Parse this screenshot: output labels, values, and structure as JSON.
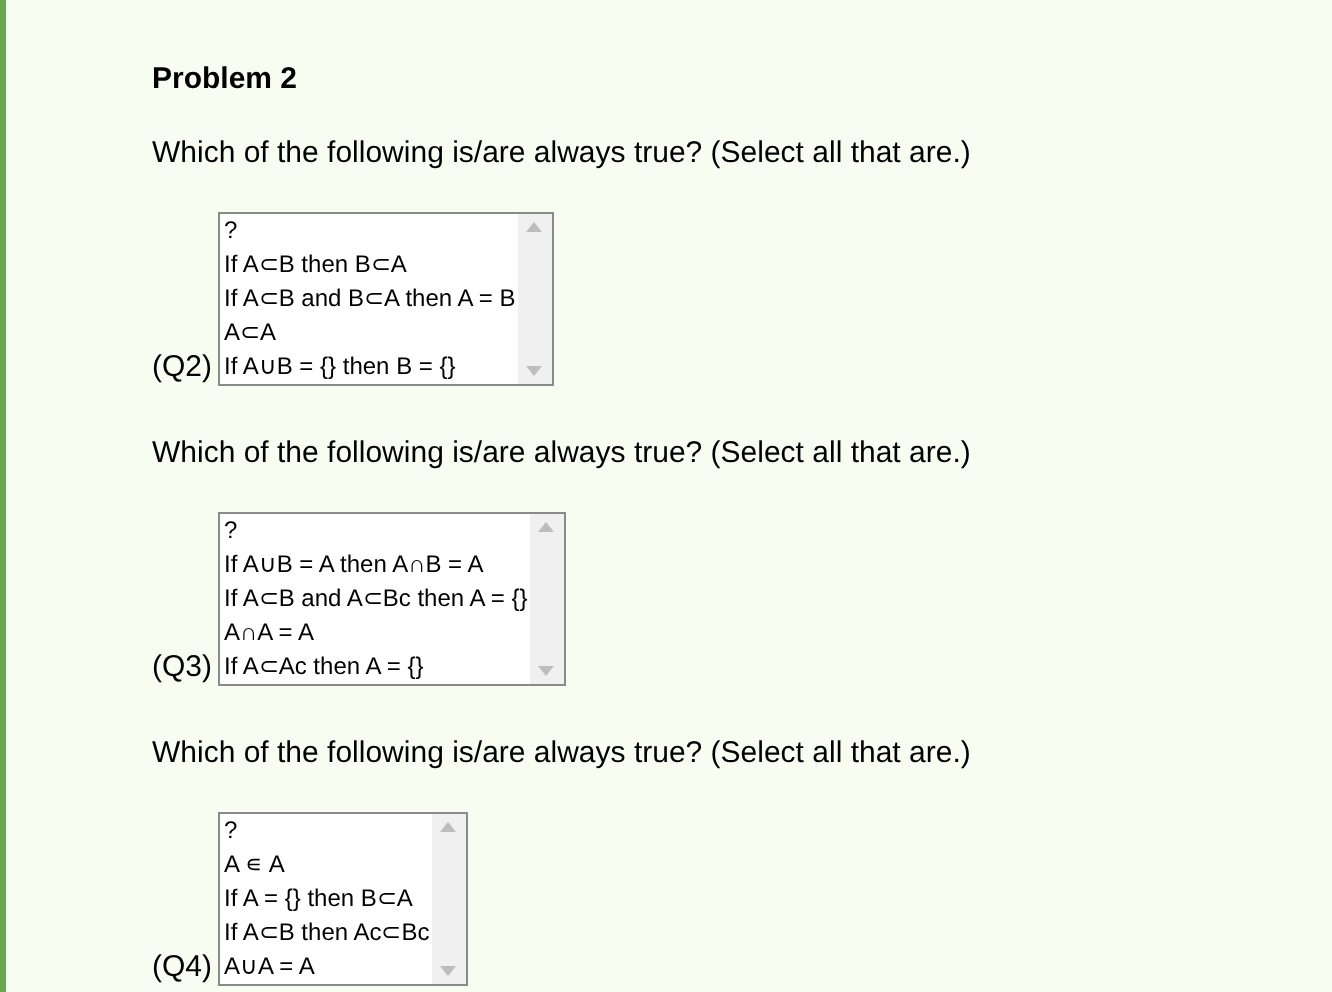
{
  "title": "Problem 2",
  "questions": [
    {
      "prompt": "Which of the following is/are always true? (Select all that are.)",
      "label": "(Q2)",
      "options": [
        "?",
        "If A⊂B then B⊂A",
        "If A⊂B and B⊂A then A = B",
        "A⊂A",
        "If A∪B = {} then B = {}"
      ]
    },
    {
      "prompt": "Which of the following is/are always true? (Select all that are.)",
      "label": "(Q3)",
      "options": [
        "?",
        "If A∪B = A then A∩B = A",
        "If A⊂B and A⊂Bc then A = {}",
        "A∩A = A",
        "If A⊂Ac then A = {}"
      ]
    },
    {
      "prompt": "Which of the following is/are always true? (Select all that are.)",
      "label": "(Q4)",
      "options": [
        "?",
        "A ∊ A",
        "If A = {} then B⊂A",
        "If A⊂B then Ac⊂Bc",
        "A∪A = A"
      ]
    }
  ]
}
